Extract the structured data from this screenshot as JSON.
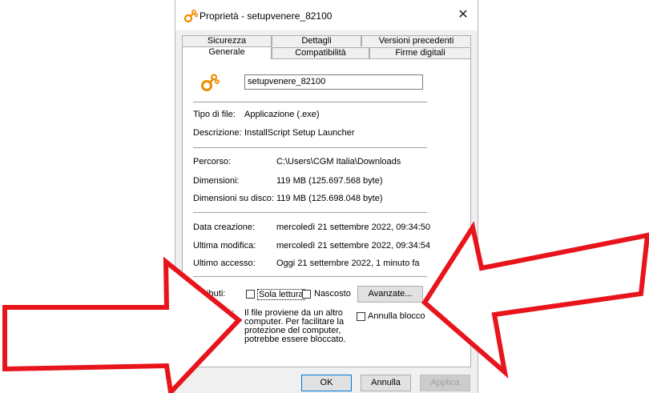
{
  "window": {
    "title": "Proprietà - setupvenere_82100",
    "close_glyph": "✕"
  },
  "tabs": {
    "row1": [
      "Sicurezza",
      "Dettagli",
      "Versioni precedenti"
    ],
    "row2": [
      "Generale",
      "Compatibilità",
      "Firme digitali"
    ],
    "active": "Generale"
  },
  "general": {
    "file_name": "setupvenere_82100",
    "file_type_label": "Tipo di file:",
    "file_type_value": "Applicazione (.exe)",
    "description_label": "Descrizione:",
    "description_value": "InstallScript Setup Launcher",
    "path_label": "Percorso:",
    "path_value": "C:\\Users\\CGM Italia\\Downloads",
    "size_label": "Dimensioni:",
    "size_value": "119 MB (125.697.568 byte)",
    "disk_size_label": "Dimensioni su disco:",
    "disk_size_value": "119 MB (125.698.048 byte)",
    "created_label": "Data creazione:",
    "created_value": "mercoledì 21 settembre 2022, 09:34:50",
    "modified_label": "Ultima modifica:",
    "modified_value": "mercoledì 21 settembre 2022, 09:34:54",
    "accessed_label": "Ultimo accesso:",
    "accessed_value": "Oggi 21 settembre 2022, 1 minuto fa",
    "attributes_label": "Attributi:",
    "readonly_label": "Sola lettura",
    "hidden_label": "Nascosto",
    "advanced_button": "Avanzate...",
    "security_label": "Sicurezza:",
    "security_text_1": "Il file proviene da un altro",
    "security_text_2": "computer. Per facilitare la",
    "security_text_3": "protezione del computer,",
    "security_text_4": "potrebbe essere bloccato.",
    "unblock_label": "Annulla blocco"
  },
  "buttons": {
    "ok": "OK",
    "cancel": "Annulla",
    "apply": "Applica"
  },
  "colors": {
    "arrow_red": "#e8141b",
    "icon_orange": "#f08a00"
  },
  "icons": [
    "app-setup-icon",
    "close-icon",
    "red-arrow-left-icon",
    "red-arrow-right-icon"
  ]
}
